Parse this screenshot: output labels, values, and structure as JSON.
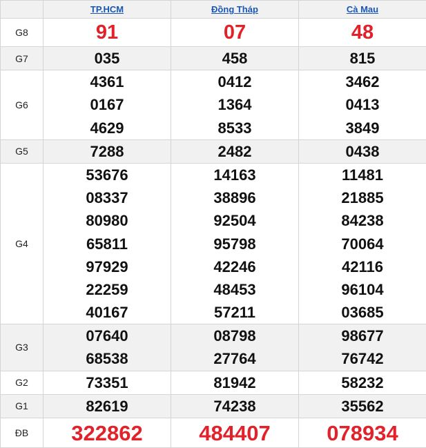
{
  "provinces": [
    "TP.HCM",
    "Đồng Tháp",
    "Cà Mau"
  ],
  "rows": [
    {
      "prize": "G8",
      "values": [
        [
          "91"
        ],
        [
          "07"
        ],
        [
          "48"
        ]
      ]
    },
    {
      "prize": "G7",
      "values": [
        [
          "035"
        ],
        [
          "458"
        ],
        [
          "815"
        ]
      ]
    },
    {
      "prize": "G6",
      "values": [
        [
          "4361",
          "0167",
          "4629"
        ],
        [
          "0412",
          "1364",
          "8533"
        ],
        [
          "3462",
          "0413",
          "3849"
        ]
      ]
    },
    {
      "prize": "G5",
      "values": [
        [
          "7288"
        ],
        [
          "2482"
        ],
        [
          "0438"
        ]
      ]
    },
    {
      "prize": "G4",
      "values": [
        [
          "53676",
          "08337",
          "80980",
          "65811",
          "97929",
          "22259",
          "40167"
        ],
        [
          "14163",
          "38896",
          "92504",
          "95798",
          "42246",
          "48453",
          "57211"
        ],
        [
          "11481",
          "21885",
          "84238",
          "70064",
          "42116",
          "96104",
          "03685"
        ]
      ]
    },
    {
      "prize": "G3",
      "values": [
        [
          "07640",
          "68538"
        ],
        [
          "08798",
          "27764"
        ],
        [
          "98677",
          "76742"
        ]
      ]
    },
    {
      "prize": "G2",
      "values": [
        [
          "73351"
        ],
        [
          "81942"
        ],
        [
          "58232"
        ]
      ]
    },
    {
      "prize": "G1",
      "values": [
        [
          "82619"
        ],
        [
          "74238"
        ],
        [
          "35562"
        ]
      ]
    },
    {
      "prize": "ĐB",
      "values": [
        [
          "322862"
        ],
        [
          "484407"
        ],
        [
          "078934"
        ]
      ]
    }
  ],
  "colors": {
    "highlight": "#e1222b",
    "link": "#1a56b5",
    "shade": "#f1f1f1"
  }
}
